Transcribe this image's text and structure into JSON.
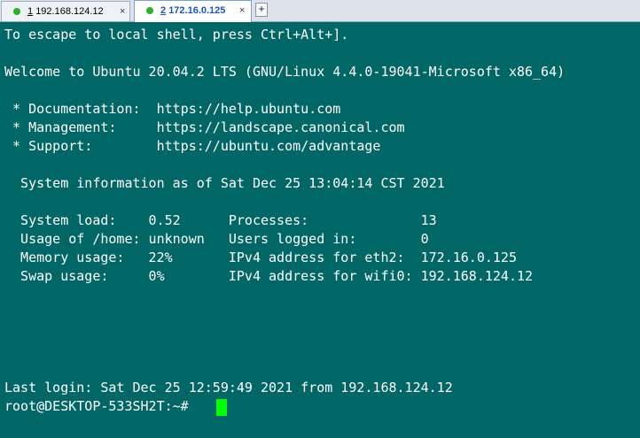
{
  "tabs": [
    {
      "number": "1",
      "title": "192.168.124.12",
      "status_color": "#25b225",
      "close_glyph": "×"
    },
    {
      "number": "2",
      "title": "172.16.0.125",
      "status_color": "#25b225",
      "close_glyph": "×",
      "active": true
    }
  ],
  "new_tab_glyph": "+",
  "terminal": {
    "background": "#006666",
    "cursor_color": "#00ff00",
    "lines": [
      "To escape to local shell, press Ctrl+Alt+].",
      "",
      "Welcome to Ubuntu 20.04.2 LTS (GNU/Linux 4.4.0-19041-Microsoft x86_64)",
      "",
      " * Documentation:  https://help.ubuntu.com",
      " * Management:     https://landscape.canonical.com",
      " * Support:        https://ubuntu.com/advantage",
      "",
      "  System information as of Sat Dec 25 13:04:14 CST 2021",
      "",
      "  System load:    0.52      Processes:              13",
      "  Usage of /home: unknown   Users logged in:        0",
      "  Memory usage:   22%       IPv4 address for eth2:  172.16.0.125",
      "  Swap usage:     0%        IPv4 address for wifi0: 192.168.124.12",
      "",
      "",
      "",
      "",
      "",
      "Last login: Sat Dec 25 12:59:49 2021 from 192.168.124.12",
      "root@DESKTOP-533SH2T:~# "
    ]
  }
}
